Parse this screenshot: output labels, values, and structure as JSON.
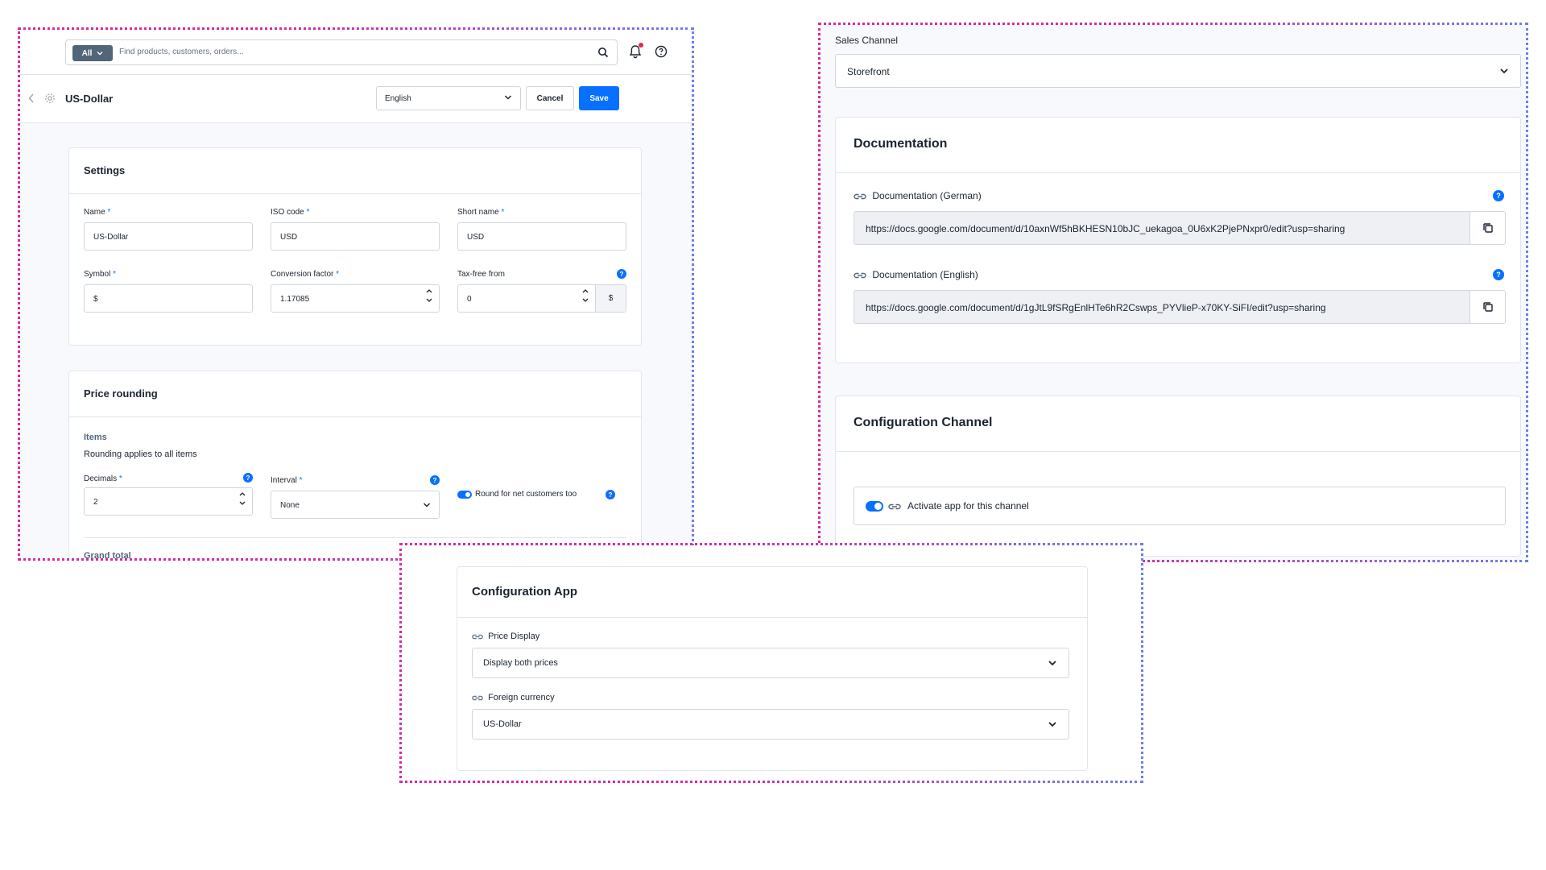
{
  "panel_a": {
    "search": {
      "scope_label": "All",
      "placeholder": "Find products, customers, orders..."
    },
    "header": {
      "title": "US-Dollar",
      "language": "English",
      "cancel_label": "Cancel",
      "save_label": "Save"
    },
    "settings": {
      "title": "Settings",
      "name": {
        "label": "Name",
        "value": "US-Dollar"
      },
      "iso_code": {
        "label": "ISO code",
        "value": "USD"
      },
      "short_name": {
        "label": "Short name",
        "value": "USD"
      },
      "symbol": {
        "label": "Symbol",
        "value": "$"
      },
      "conversion_factor": {
        "label": "Conversion factor",
        "value": "1.17085"
      },
      "tax_free_from": {
        "label": "Tax-free from",
        "value": "0",
        "unit": "$"
      }
    },
    "price_rounding": {
      "title": "Price rounding",
      "items_heading": "Items",
      "items_description": "Rounding applies to all items",
      "decimals": {
        "label": "Decimals",
        "value": "2"
      },
      "interval": {
        "label": "Interval",
        "value": "None"
      },
      "round_net": {
        "label": "Round for net customers too",
        "enabled": true
      },
      "grand_total_heading": "Grand total"
    },
    "required_marker": "*"
  },
  "panel_b": {
    "sales_channel": {
      "label": "Sales Channel",
      "value": "Storefront"
    },
    "documentation": {
      "title": "Documentation",
      "german": {
        "label": "Documentation (German)",
        "url": "https://docs.google.com/document/d/10axnWf5hBKHESN10bJC_uekagoa_0U6xK2PjePNxpr0/edit?usp=sharing"
      },
      "english": {
        "label": "Documentation (English)",
        "url": "https://docs.google.com/document/d/1gJtL9fSRgEnlHTe6hR2Cswps_PYVlieP-x70KY-SiFI/edit?usp=sharing"
      }
    },
    "configuration_channel": {
      "title": "Configuration Channel",
      "activate_label": "Activate app for this channel",
      "activate_enabled": true
    }
  },
  "panel_c": {
    "title": "Configuration App",
    "price_display": {
      "label": "Price Display",
      "value": "Display both prices"
    },
    "foreign_currency": {
      "label": "Foreign currency",
      "value": "US-Dollar"
    }
  },
  "colors": {
    "accent": "#0870ff",
    "frame_pink": "#d62aa6",
    "frame_blue": "#6f7cf0",
    "notification_dot": "#de294c"
  }
}
